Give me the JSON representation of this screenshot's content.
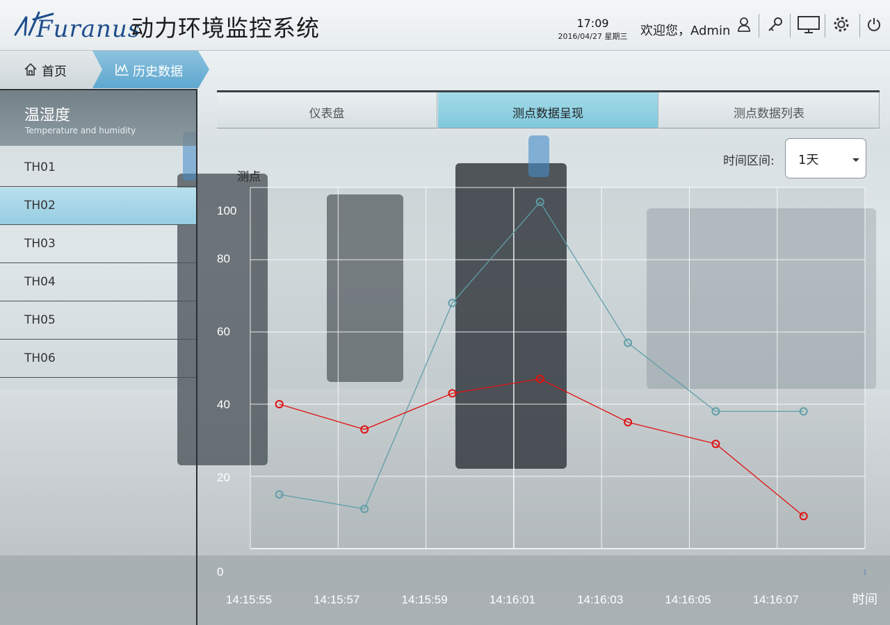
{
  "header": {
    "logo_text": "Furanus",
    "system_title": "动力环境监控系统",
    "time": "17:09",
    "date": "2016/04/27 星期三",
    "welcome": "欢迎您，Admin",
    "icons": [
      "user-icon",
      "key-icon",
      "monitor-icon",
      "gear-icon",
      "power-icon"
    ]
  },
  "breadcrumb": {
    "home": "首页",
    "current": "历史数据"
  },
  "sidebar": {
    "title": "温湿度",
    "subtitle": "Temperature and humidity",
    "items": [
      {
        "label": "TH01",
        "active": false
      },
      {
        "label": "TH02",
        "active": true
      },
      {
        "label": "TH03",
        "active": false
      },
      {
        "label": "TH04",
        "active": false
      },
      {
        "label": "TH05",
        "active": false
      },
      {
        "label": "TH06",
        "active": false
      }
    ]
  },
  "tabs": [
    {
      "label": "仪表盘",
      "active": false
    },
    {
      "label": "测点数据呈现",
      "active": true
    },
    {
      "label": "测点数据列表",
      "active": false
    }
  ],
  "time_range": {
    "label": "时间区间:",
    "value": "1天"
  },
  "colors": {
    "series_teal": "#5f9ea8",
    "series_red": "#e01010",
    "active_blue": "#8cc3df"
  },
  "chart_data": {
    "type": "line",
    "ylabel": "测点",
    "xlabel": "时间",
    "ylim": [
      0,
      100
    ],
    "yticks": [
      0,
      20,
      40,
      60,
      80,
      100
    ],
    "categories": [
      "14:15:55",
      "14:15:57",
      "14:15:59",
      "14:16:01",
      "14:16:03",
      "14:16:05",
      "14:16:07"
    ],
    "grid": true,
    "series": [
      {
        "color": "#5f9ea8",
        "x": [
          0.33,
          1.3,
          2.3,
          3.3,
          4.3,
          5.3,
          6.3
        ],
        "values": [
          15,
          11,
          68,
          96,
          57,
          38,
          38
        ]
      },
      {
        "color": "#e01010",
        "x": [
          0.33,
          1.3,
          2.3,
          3.3,
          4.3,
          5.3,
          6.3
        ],
        "values": [
          40,
          33,
          43,
          47,
          35,
          29,
          9
        ]
      }
    ]
  }
}
